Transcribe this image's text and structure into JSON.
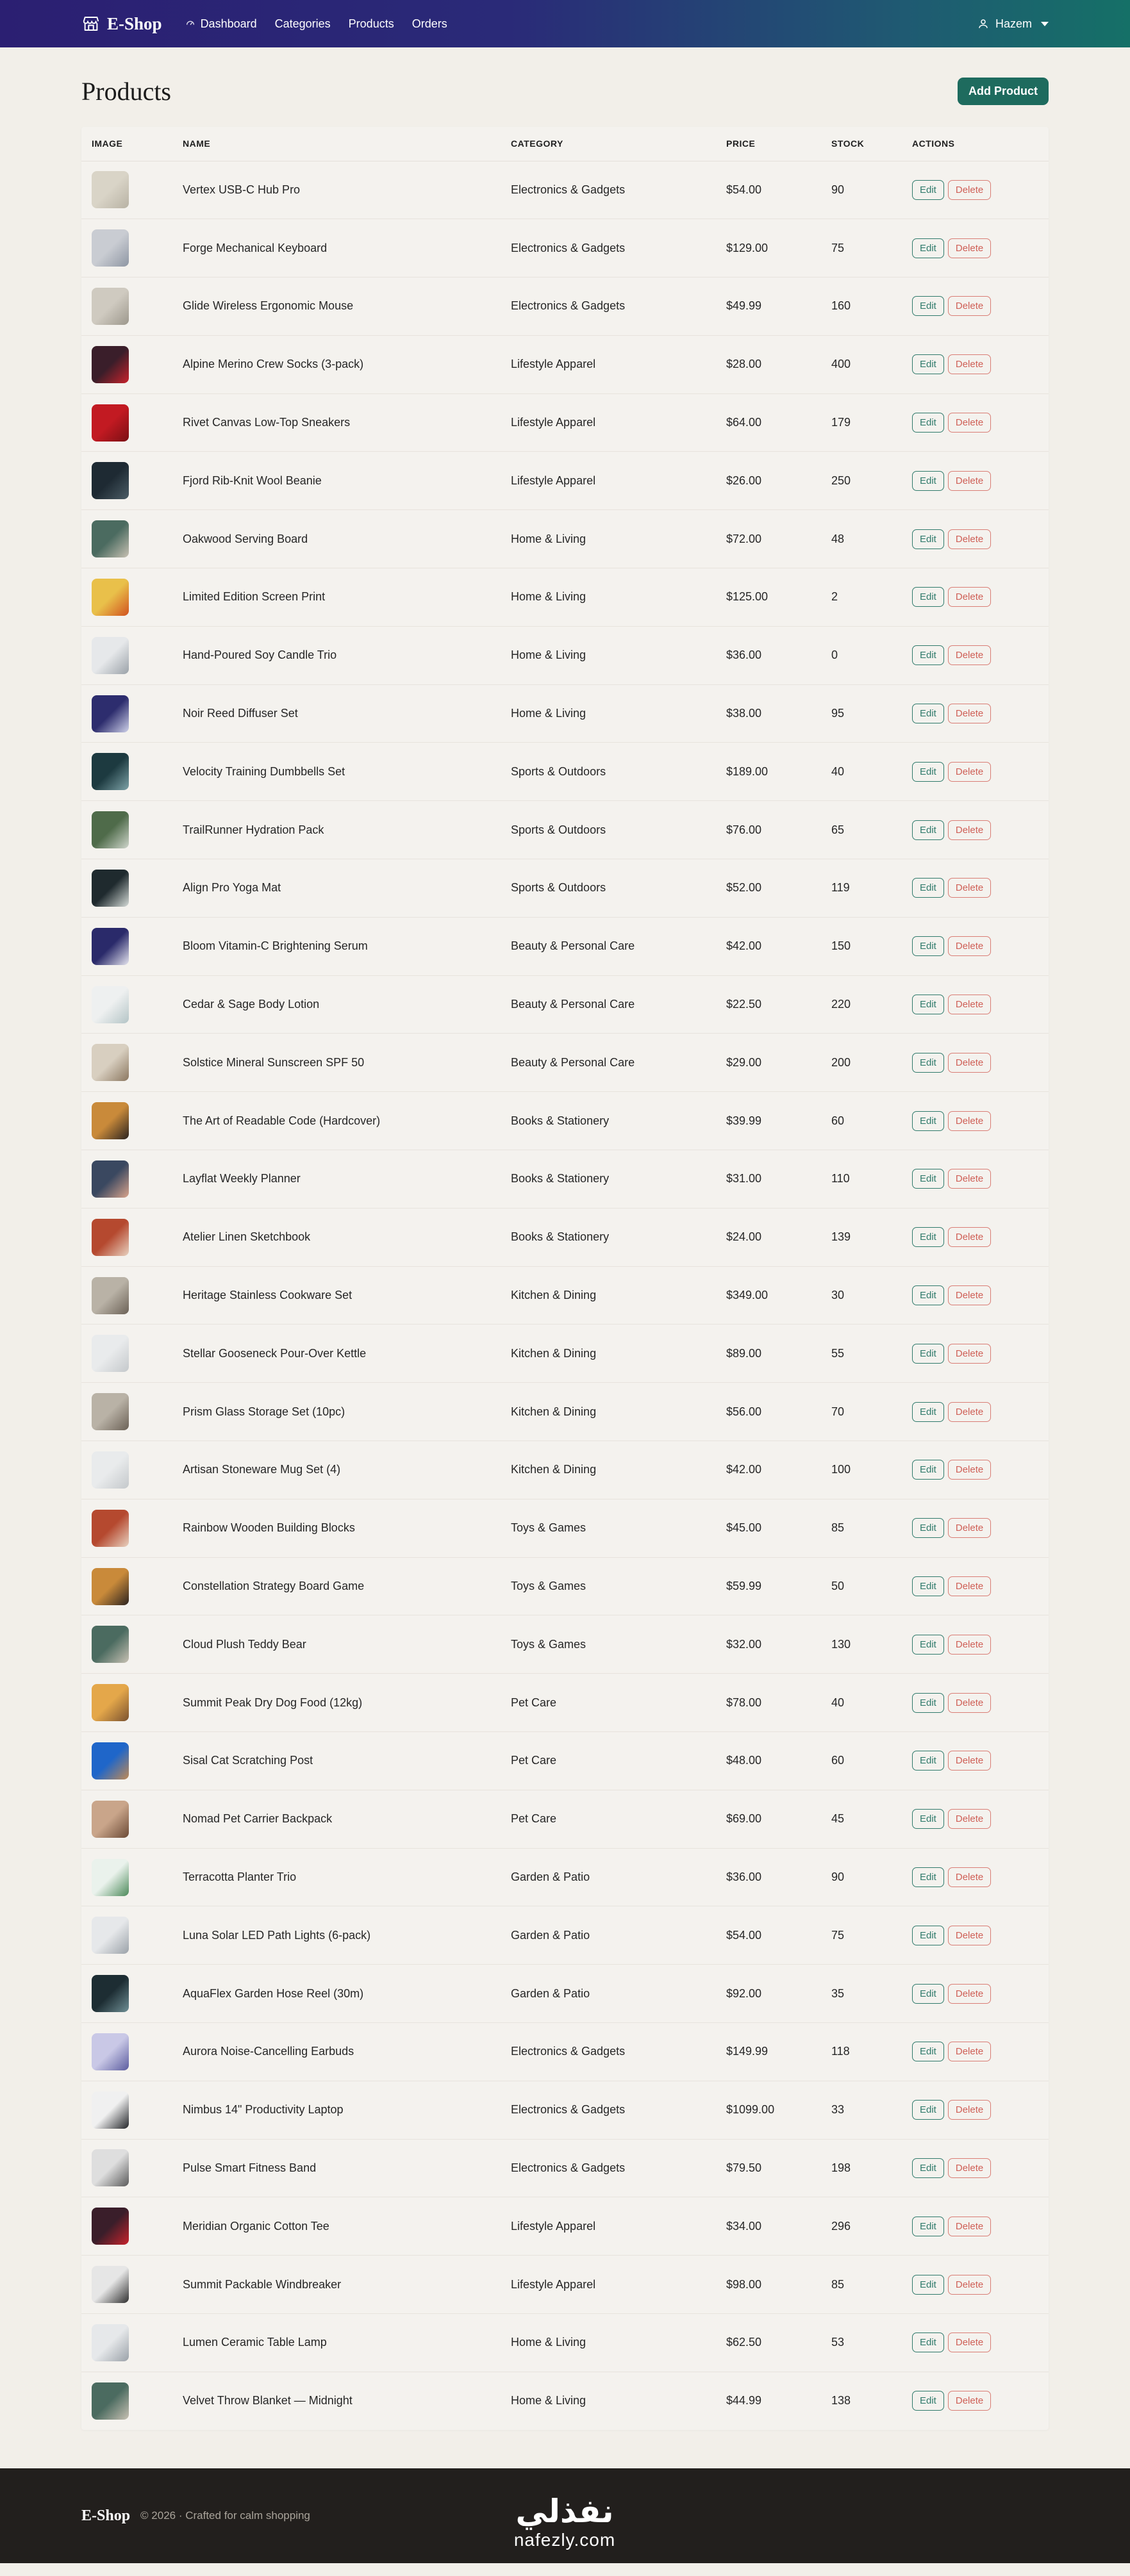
{
  "nav": {
    "brand": "E-Shop",
    "links": [
      "Dashboard",
      "Categories",
      "Products",
      "Orders"
    ],
    "user": "Hazem"
  },
  "page": {
    "title": "Products",
    "add_label": "Add Product"
  },
  "table": {
    "headers": [
      "IMAGE",
      "NAME",
      "CATEGORY",
      "PRICE",
      "STOCK",
      "ACTIONS"
    ],
    "edit_label": "Edit",
    "delete_label": "Delete",
    "rows": [
      {
        "name": "Vertex USB-C Hub Pro",
        "category": "Electronics & Gadgets",
        "price": "$54.00",
        "stock": "90"
      },
      {
        "name": "Forge Mechanical Keyboard",
        "category": "Electronics & Gadgets",
        "price": "$129.00",
        "stock": "75"
      },
      {
        "name": "Glide Wireless Ergonomic Mouse",
        "category": "Electronics & Gadgets",
        "price": "$49.99",
        "stock": "160"
      },
      {
        "name": "Alpine Merino Crew Socks (3-pack)",
        "category": "Lifestyle Apparel",
        "price": "$28.00",
        "stock": "400"
      },
      {
        "name": "Rivet Canvas Low-Top Sneakers",
        "category": "Lifestyle Apparel",
        "price": "$64.00",
        "stock": "179"
      },
      {
        "name": "Fjord Rib-Knit Wool Beanie",
        "category": "Lifestyle Apparel",
        "price": "$26.00",
        "stock": "250"
      },
      {
        "name": "Oakwood Serving Board",
        "category": "Home & Living",
        "price": "$72.00",
        "stock": "48"
      },
      {
        "name": "Limited Edition Screen Print",
        "category": "Home & Living",
        "price": "$125.00",
        "stock": "2"
      },
      {
        "name": "Hand-Poured Soy Candle Trio",
        "category": "Home & Living",
        "price": "$36.00",
        "stock": "0"
      },
      {
        "name": "Noir Reed Diffuser Set",
        "category": "Home & Living",
        "price": "$38.00",
        "stock": "95"
      },
      {
        "name": "Velocity Training Dumbbells Set",
        "category": "Sports & Outdoors",
        "price": "$189.00",
        "stock": "40"
      },
      {
        "name": "TrailRunner Hydration Pack",
        "category": "Sports & Outdoors",
        "price": "$76.00",
        "stock": "65"
      },
      {
        "name": "Align Pro Yoga Mat",
        "category": "Sports & Outdoors",
        "price": "$52.00",
        "stock": "119"
      },
      {
        "name": "Bloom Vitamin-C Brightening Serum",
        "category": "Beauty & Personal Care",
        "price": "$42.00",
        "stock": "150"
      },
      {
        "name": "Cedar & Sage Body Lotion",
        "category": "Beauty & Personal Care",
        "price": "$22.50",
        "stock": "220"
      },
      {
        "name": "Solstice Mineral Sunscreen SPF 50",
        "category": "Beauty & Personal Care",
        "price": "$29.00",
        "stock": "200"
      },
      {
        "name": "The Art of Readable Code (Hardcover)",
        "category": "Books & Stationery",
        "price": "$39.99",
        "stock": "60"
      },
      {
        "name": "Layflat Weekly Planner",
        "category": "Books & Stationery",
        "price": "$31.00",
        "stock": "110"
      },
      {
        "name": "Atelier Linen Sketchbook",
        "category": "Books & Stationery",
        "price": "$24.00",
        "stock": "139"
      },
      {
        "name": "Heritage Stainless Cookware Set",
        "category": "Kitchen & Dining",
        "price": "$349.00",
        "stock": "30"
      },
      {
        "name": "Stellar Gooseneck Pour-Over Kettle",
        "category": "Kitchen & Dining",
        "price": "$89.00",
        "stock": "55"
      },
      {
        "name": "Prism Glass Storage Set (10pc)",
        "category": "Kitchen & Dining",
        "price": "$56.00",
        "stock": "70"
      },
      {
        "name": "Artisan Stoneware Mug Set (4)",
        "category": "Kitchen & Dining",
        "price": "$42.00",
        "stock": "100"
      },
      {
        "name": "Rainbow Wooden Building Blocks",
        "category": "Toys & Games",
        "price": "$45.00",
        "stock": "85"
      },
      {
        "name": "Constellation Strategy Board Game",
        "category": "Toys & Games",
        "price": "$59.99",
        "stock": "50"
      },
      {
        "name": "Cloud Plush Teddy Bear",
        "category": "Toys & Games",
        "price": "$32.00",
        "stock": "130"
      },
      {
        "name": "Summit Peak Dry Dog Food (12kg)",
        "category": "Pet Care",
        "price": "$78.00",
        "stock": "40"
      },
      {
        "name": "Sisal Cat Scratching Post",
        "category": "Pet Care",
        "price": "$48.00",
        "stock": "60"
      },
      {
        "name": "Nomad Pet Carrier Backpack",
        "category": "Pet Care",
        "price": "$69.00",
        "stock": "45"
      },
      {
        "name": "Terracotta Planter Trio",
        "category": "Garden & Patio",
        "price": "$36.00",
        "stock": "90"
      },
      {
        "name": "Luna Solar LED Path Lights (6-pack)",
        "category": "Garden & Patio",
        "price": "$54.00",
        "stock": "75"
      },
      {
        "name": "AquaFlex Garden Hose Reel (30m)",
        "category": "Garden & Patio",
        "price": "$92.00",
        "stock": "35"
      },
      {
        "name": "Aurora Noise-Cancelling Earbuds",
        "category": "Electronics & Gadgets",
        "price": "$149.99",
        "stock": "118"
      },
      {
        "name": "Nimbus 14\" Productivity Laptop",
        "category": "Electronics & Gadgets",
        "price": "$1099.00",
        "stock": "33"
      },
      {
        "name": "Pulse Smart Fitness Band",
        "category": "Electronics & Gadgets",
        "price": "$79.50",
        "stock": "198"
      },
      {
        "name": "Meridian Organic Cotton Tee",
        "category": "Lifestyle Apparel",
        "price": "$34.00",
        "stock": "296"
      },
      {
        "name": "Summit Packable Windbreaker",
        "category": "Lifestyle Apparel",
        "price": "$98.00",
        "stock": "85"
      },
      {
        "name": "Lumen Ceramic Table Lamp",
        "category": "Home & Living",
        "price": "$62.50",
        "stock": "53"
      },
      {
        "name": "Velvet Throw Blanket — Midnight",
        "category": "Home & Living",
        "price": "$44.99",
        "stock": "138"
      }
    ]
  },
  "footer": {
    "brand": "E-Shop",
    "copy": "© 2026 · Crafted for calm shopping",
    "watermark_logo": "نفذلي",
    "watermark_url": "nafezly.com"
  },
  "colors": {
    "accent": "#1e6b5e",
    "edit": "#2f7a6b",
    "delete": "#cf5f56",
    "footer_bg": "#221f1d"
  }
}
